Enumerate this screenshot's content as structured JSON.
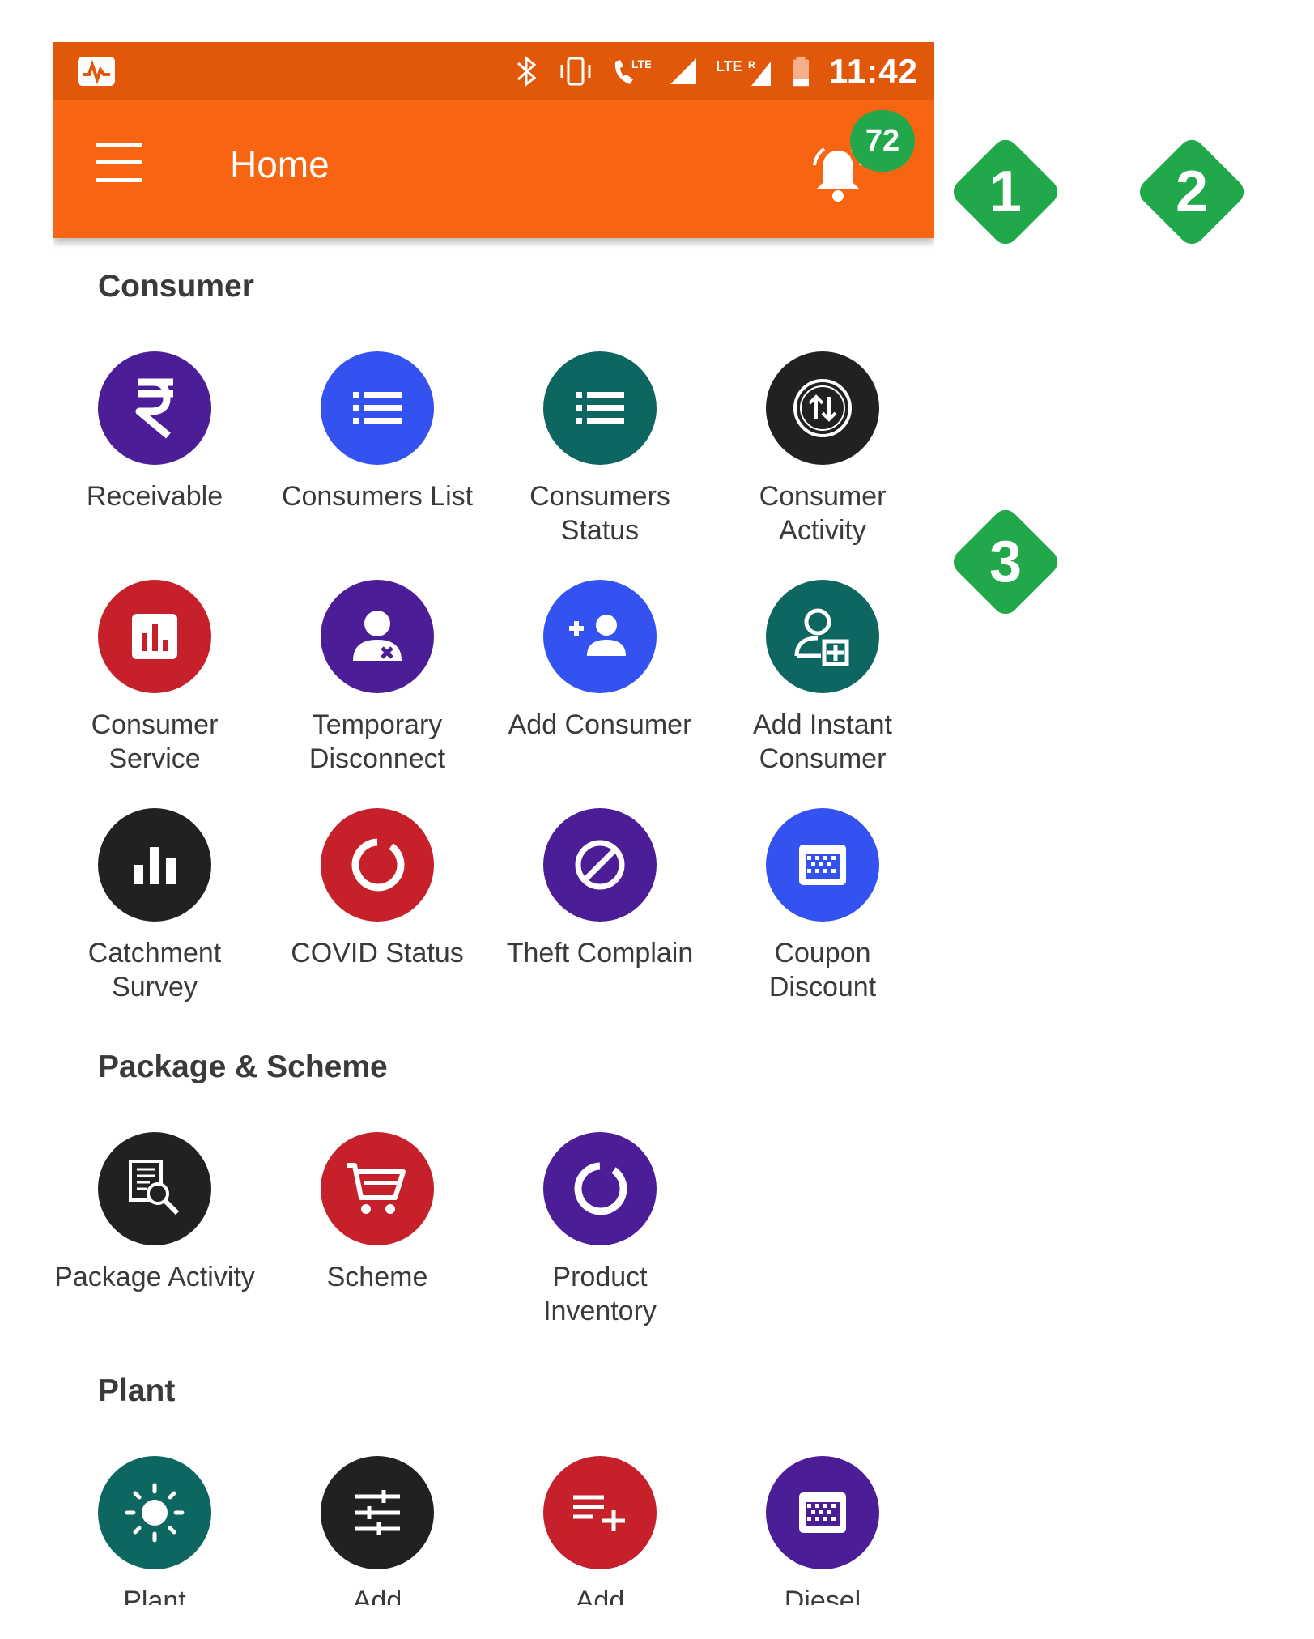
{
  "status_bar": {
    "time": "11:42"
  },
  "app_bar": {
    "title": "Home",
    "notification_count": "72"
  },
  "sections": {
    "consumer": {
      "title": "Consumer",
      "items": [
        {
          "label": "Receivable",
          "color": "#4b1d96",
          "icon": "rupee-icon"
        },
        {
          "label": "Consumers List",
          "color": "#3352f0",
          "icon": "list-icon"
        },
        {
          "label": "Consumers Status",
          "color": "#0e6661",
          "icon": "list-icon"
        },
        {
          "label": "Consumer Activity",
          "color": "#212121",
          "icon": "swap-circle-icon"
        },
        {
          "label": "Consumer Service",
          "color": "#c6202a",
          "icon": "bar-chart-box-icon"
        },
        {
          "label": "Temporary Disconnect",
          "color": "#4b1d96",
          "icon": "user-remove-icon"
        },
        {
          "label": "Add Consumer",
          "color": "#3352f0",
          "icon": "add-user-icon"
        },
        {
          "label": "Add Instant Consumer",
          "color": "#0e6661",
          "icon": "add-user-outline-icon"
        },
        {
          "label": "Catchment Survey",
          "color": "#212121",
          "icon": "bar-chart-icon"
        },
        {
          "label": "COVID Status",
          "color": "#c6202a",
          "icon": "ring-icon"
        },
        {
          "label": "Theft Complain",
          "color": "#4b1d96",
          "icon": "block-icon"
        },
        {
          "label": "Coupon Discount",
          "color": "#3352f0",
          "icon": "grid-card-icon"
        }
      ]
    },
    "package": {
      "title": "Package & Scheme",
      "items": [
        {
          "label": "Package Activity",
          "color": "#212121",
          "icon": "document-search-icon"
        },
        {
          "label": "Scheme",
          "color": "#c6202a",
          "icon": "cart-icon"
        },
        {
          "label": "Product Inventory",
          "color": "#4b1d96",
          "icon": "ring-icon"
        }
      ]
    },
    "plant": {
      "title": "Plant",
      "items": [
        {
          "label": "Plant",
          "color": "#0e6661",
          "icon": "sun-icon"
        },
        {
          "label": "Add",
          "color": "#212121",
          "icon": "sliders-icon"
        },
        {
          "label": "Add",
          "color": "#c6202a",
          "icon": "playlist-add-icon"
        },
        {
          "label": "Diesel",
          "color": "#4b1d96",
          "icon": "grid-card-icon"
        }
      ]
    }
  },
  "markers": [
    "1",
    "2",
    "3"
  ],
  "colors": {
    "status_bar": "#e1580a",
    "app_bar": "#f76513",
    "badge": "#22a84a",
    "marker": "#21a84a"
  }
}
